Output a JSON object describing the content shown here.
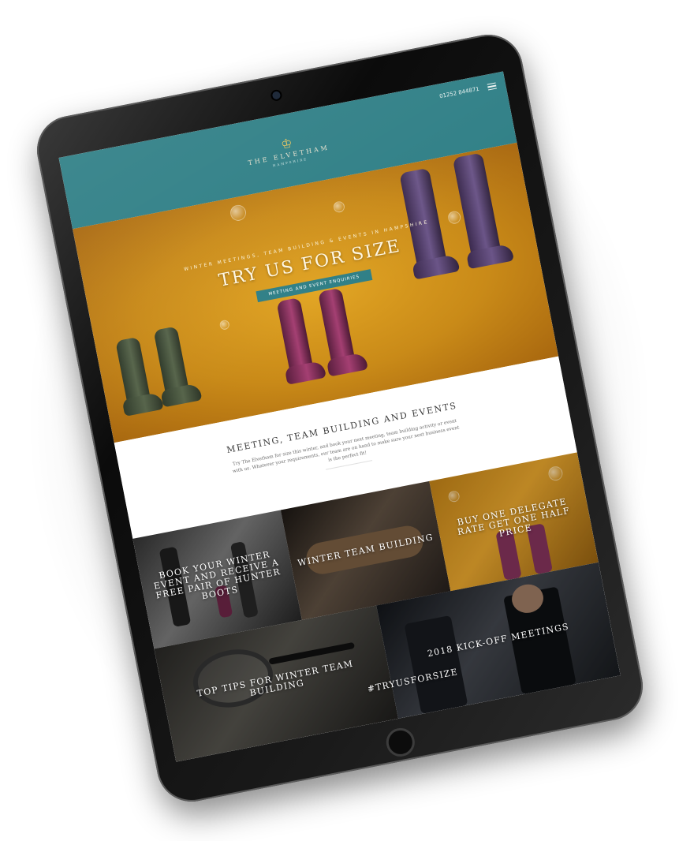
{
  "header": {
    "logo_mark": "♔",
    "brand_name": "THE ELVETHAM",
    "brand_sub": "HAMPSHIRE",
    "phone": "01252 844871",
    "menu_icon": "hamburger-icon"
  },
  "hero": {
    "eyebrow": "WINTER MEETINGS, TEAM BUILDING & EVENTS IN HAMPSHIRE",
    "title": "TRY US FOR SIZE",
    "cta_label": "MEETING AND EVENT ENQUIRIES"
  },
  "intro": {
    "title": "MEETING, TEAM BUILDING AND EVENTS",
    "body": "Try The Elvetham for size this winter, and book your next meeting, team building activity or event with us. Whatever your requirements, our team are on hand to make sure your next business event is the perfect fit!"
  },
  "tiles": [
    {
      "label": "BOOK YOUR WINTER EVENT AND RECEIVE A FREE PAIR OF HUNTER BOOTS"
    },
    {
      "label": "WINTER TEAM BUILDING"
    },
    {
      "label": "BUY ONE DELEGATE RATE GET ONE HALF PRICE"
    },
    {
      "label": "TOP TIPS FOR WINTER TEAM BUILDING"
    },
    {
      "label": "2018 KICK-OFF MEETINGS"
    },
    {
      "label": "#TRYUSFORSIZE"
    }
  ],
  "colors": {
    "teal": "#2f7f86",
    "mustard": "#d59a21",
    "device": "#111111"
  }
}
